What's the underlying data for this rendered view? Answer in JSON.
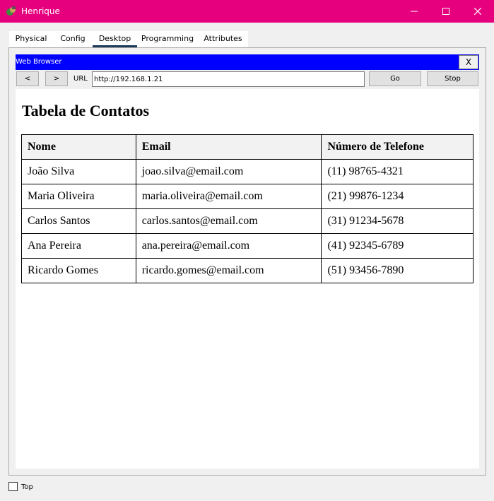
{
  "window": {
    "title": "Henrique",
    "accent_color": "#e6007e",
    "icons": [
      "app-icon",
      "minimize-icon",
      "maximize-icon",
      "close-icon"
    ]
  },
  "tabs": [
    {
      "label": "Physical"
    },
    {
      "label": "Config"
    },
    {
      "label": "Desktop",
      "active": true
    },
    {
      "label": "Programming"
    },
    {
      "label": "Attributes"
    }
  ],
  "browser": {
    "title": "Web Browser",
    "title_bar_color": "#0000ff",
    "close_label": "X",
    "back_label": "<",
    "forward_label": ">",
    "url_label": "URL",
    "url_value": "http://192.168.1.21",
    "go_label": "Go",
    "stop_label": "Stop"
  },
  "page": {
    "heading": "Tabela de Contatos",
    "table": {
      "headers": [
        "Nome",
        "Email",
        "Número de Telefone"
      ],
      "rows": [
        [
          "João Silva",
          "joao.silva@email.com",
          "(11) 98765-4321"
        ],
        [
          "Maria Oliveira",
          "maria.oliveira@email.com",
          "(21) 99876-1234"
        ],
        [
          "Carlos Santos",
          "carlos.santos@email.com",
          "(31) 91234-5678"
        ],
        [
          "Ana Pereira",
          "ana.pereira@email.com",
          "(41) 92345-6789"
        ],
        [
          "Ricardo Gomes",
          "ricardo.gomes@email.com",
          "(51) 93456-7890"
        ]
      ]
    }
  },
  "footer": {
    "top_label": "Top",
    "top_checked": false
  }
}
